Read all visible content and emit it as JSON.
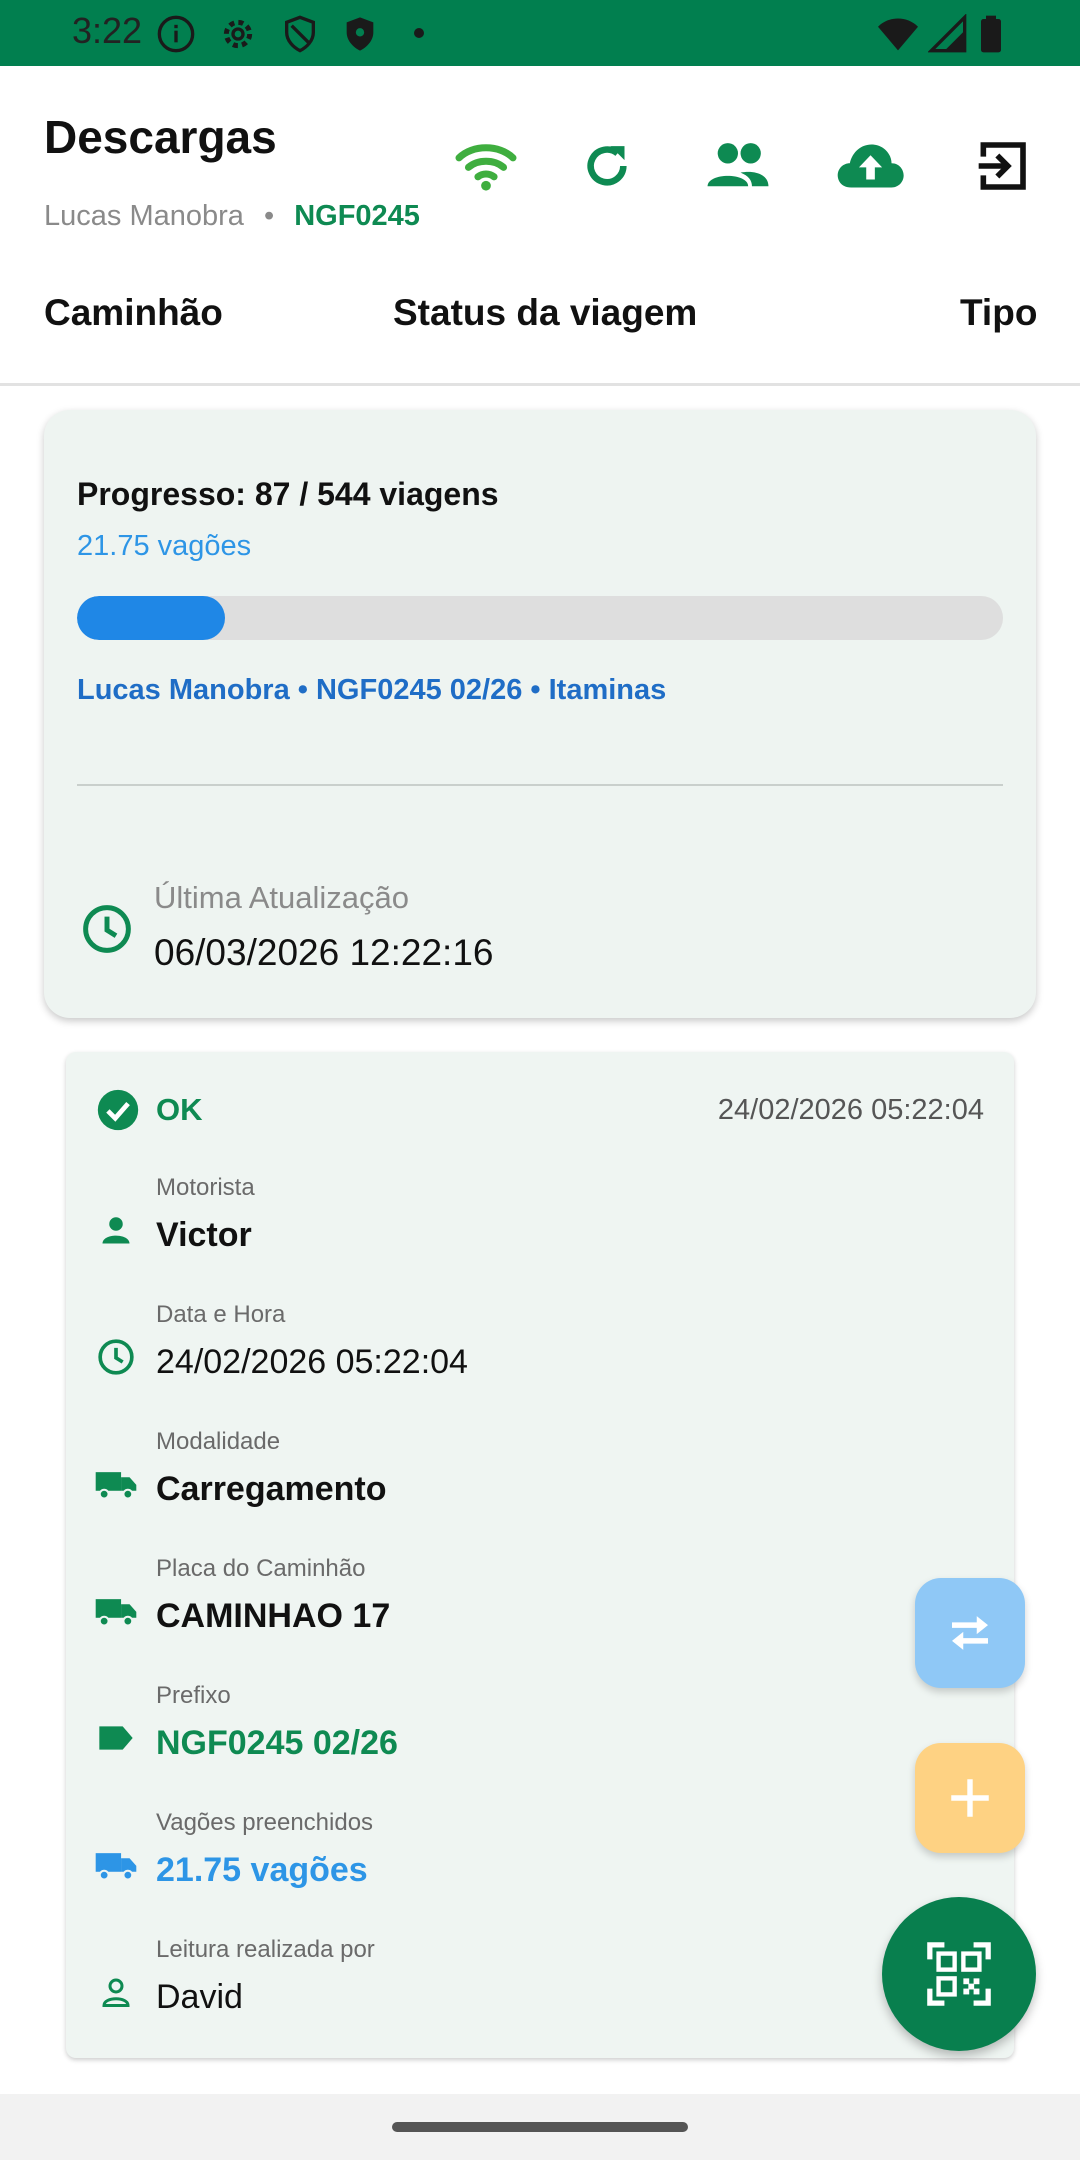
{
  "status_bar": {
    "time": "3:22",
    "icons": [
      "info-icon",
      "gear-icon",
      "shield-icon",
      "shield-filled-icon",
      "dot-icon",
      "wifi-icon",
      "signal-icon",
      "battery-icon"
    ],
    "background": "#017f4f"
  },
  "header": {
    "title": "Descargas",
    "user": "Lucas Manobra",
    "separator": "•",
    "plate": "NGF0245",
    "actions": [
      "wifi-icon",
      "refresh-icon",
      "people-icon",
      "cloud-upload-icon",
      "logout-icon"
    ]
  },
  "tabs": [
    {
      "label": "Caminhão"
    },
    {
      "label": "Status da viagem"
    },
    {
      "label": "Tipo"
    }
  ],
  "progress_card": {
    "title": "Progresso: 87 / 544 viagens",
    "wagons": "21.75 vagões",
    "progress_fraction": 0.16,
    "info": "Lucas Manobra • NGF0245 02/26 • Itaminas",
    "last_update_label": "Última Atualização",
    "last_update_value": "06/03/2026 12:22:16"
  },
  "trip_card": {
    "status": "OK",
    "date": "24/02/2026 05:22:04",
    "rows": [
      {
        "icon": "person-icon",
        "label": "Motorista",
        "value": "Victor"
      },
      {
        "icon": "clock-icon",
        "label": "Data e Hora",
        "value": "24/02/2026 05:22:04"
      },
      {
        "icon": "truck-icon",
        "label": "Modalidade",
        "value": "Carregamento"
      },
      {
        "icon": "truck-icon",
        "label": "Placa do Caminhão",
        "value": "CAMINHAO 17"
      },
      {
        "icon": "tag-icon",
        "label": "Prefixo",
        "value": "NGF0245 02/26"
      },
      {
        "icon": "truck-icon",
        "label": "Vagões preenchidos",
        "value": "21.75 vagões"
      },
      {
        "icon": "person-outline-icon",
        "label": "Leitura realizada por",
        "value": "David"
      }
    ]
  },
  "fabs": [
    "swap-icon",
    "add-icon",
    "qr-code-icon"
  ],
  "colors": {
    "brand_green": "#0e8a52",
    "accent_blue": "#2d95e6",
    "progress_fill": "#1f87e6",
    "fab_swap": "#8fc8f6",
    "fab_add": "#fed283",
    "fab_qr": "#087f4e"
  }
}
